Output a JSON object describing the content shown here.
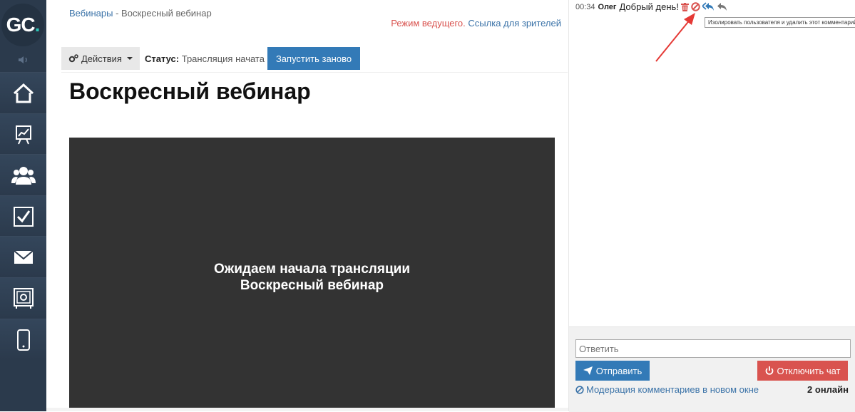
{
  "sidebar": {
    "logo": {
      "text": "GC",
      "dot": "."
    },
    "items": [
      {
        "icon": "home-icon"
      },
      {
        "icon": "chart-icon"
      },
      {
        "icon": "users-icon"
      },
      {
        "icon": "checkbox-icon"
      },
      {
        "icon": "mail-icon"
      },
      {
        "icon": "safe-icon"
      },
      {
        "icon": "mobile-icon"
      }
    ]
  },
  "breadcrumb": {
    "link": "Вебинары",
    "separator": "-",
    "current": "Воскресный вебинар"
  },
  "mode": {
    "host": "Режим ведущего.",
    "viewers_link": "Ссылка для зрителей"
  },
  "toolbar": {
    "actions_label": "Действия",
    "status_label": "Статус:",
    "status_value": "Трансляция начата",
    "restart_label": "Запустить заново"
  },
  "page": {
    "title": "Воскресный вебинар"
  },
  "player": {
    "line1": "Ожидаем начала трансляции",
    "line2": "Воскресный вебинар"
  },
  "chat": {
    "message": {
      "time": "00:34",
      "author": "Олег",
      "text": "Добрый день!",
      "icons": [
        "trash-icon",
        "ban-icon",
        "reply-all-icon",
        "reply-icon"
      ]
    },
    "tooltip": "Изолировать пользователя и удалить этот комментарий",
    "reply_placeholder": "Ответить",
    "send_label": "Отправить",
    "disable_label": "Отключить чат",
    "moderation_link": "Модерация комментариев в новом окне",
    "online": "2 онлайн"
  },
  "colors": {
    "sidebar": "#2b3a4c",
    "primary": "#337ab7",
    "danger": "#d9534f",
    "link": "#3b73a8",
    "player_bg": "#333333",
    "annotation_arrow": "#e53935"
  }
}
